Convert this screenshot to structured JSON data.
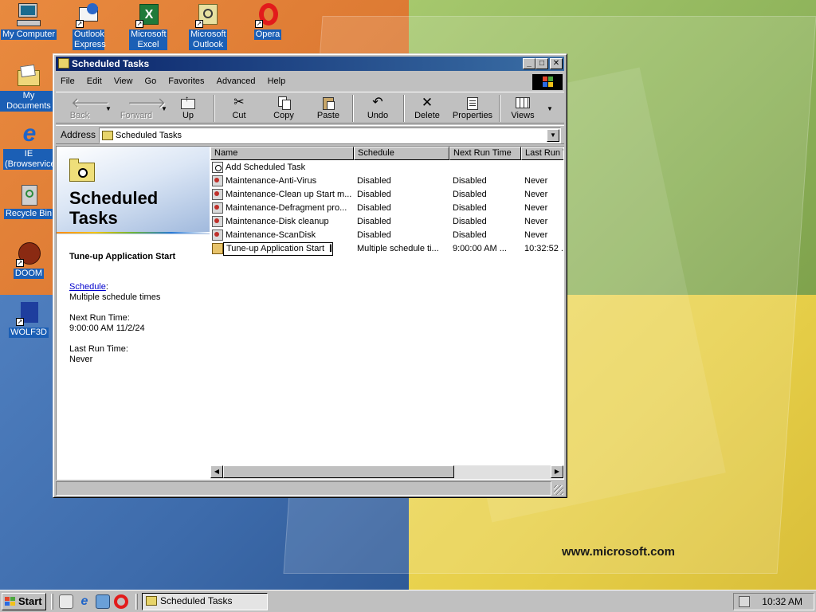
{
  "desktop": {
    "watermark": "www.microsoft.com",
    "icons": [
      {
        "label": "My Computer",
        "icon": "my-computer-icon"
      },
      {
        "label": "Outlook Express",
        "icon": "outlook-express-icon"
      },
      {
        "label": "Microsoft Excel",
        "icon": "excel-icon"
      },
      {
        "label": "Microsoft Outlook",
        "icon": "outlook-icon"
      },
      {
        "label": "Opera",
        "icon": "opera-icon"
      },
      {
        "label": "My Documents",
        "icon": "my-documents-icon"
      },
      {
        "label": "IE (Browservice)",
        "icon": "internet-explorer-icon"
      },
      {
        "label": "Recycle Bin",
        "icon": "recycle-bin-icon"
      },
      {
        "label": "DOOM",
        "icon": "doom-icon"
      },
      {
        "label": "WOLF3D",
        "icon": "wolf3d-icon"
      }
    ]
  },
  "window": {
    "title": "Scheduled Tasks",
    "menu": [
      {
        "label": "File",
        "key": "F"
      },
      {
        "label": "Edit",
        "key": "E"
      },
      {
        "label": "View",
        "key": "V"
      },
      {
        "label": "Go",
        "key": "G"
      },
      {
        "label": "Favorites",
        "key": "a"
      },
      {
        "label": "Advanced",
        "key": "A"
      },
      {
        "label": "Help",
        "key": "H"
      }
    ],
    "toolbar": {
      "back": "Back",
      "forward": "Forward",
      "up": "Up",
      "cut": "Cut",
      "copy": "Copy",
      "paste": "Paste",
      "undo": "Undo",
      "delete": "Delete",
      "properties": "Properties",
      "views": "Views"
    },
    "address": {
      "label": "Address",
      "value": "Scheduled Tasks"
    },
    "left_pane": {
      "title": "Scheduled Tasks",
      "selected_name": "Tune-up Application Start",
      "schedule_label": "Schedule",
      "schedule_value": "Multiple schedule times",
      "next_run_label": "Next Run Time:",
      "next_run_value": "9:00:00 AM 11/2/24",
      "last_run_label": "Last Run Time:",
      "last_run_value": "Never"
    },
    "columns": [
      "Name",
      "Schedule",
      "Next Run Time",
      "Last Run T"
    ],
    "rows": [
      {
        "name": "Add Scheduled Task",
        "schedule": "",
        "next": "",
        "last": "",
        "icon": "add-task-icon"
      },
      {
        "name": "Maintenance-Anti-Virus",
        "schedule": "Disabled",
        "next": "Disabled",
        "last": "Never",
        "icon": "task-icon"
      },
      {
        "name": "Maintenance-Clean up Start m...",
        "schedule": "Disabled",
        "next": "Disabled",
        "last": "Never",
        "icon": "task-icon"
      },
      {
        "name": "Maintenance-Defragment pro...",
        "schedule": "Disabled",
        "next": "Disabled",
        "last": "Never",
        "icon": "task-icon"
      },
      {
        "name": "Maintenance-Disk cleanup",
        "schedule": "Disabled",
        "next": "Disabled",
        "last": "Never",
        "icon": "task-icon"
      },
      {
        "name": "Maintenance-ScanDisk",
        "schedule": "Disabled",
        "next": "Disabled",
        "last": "Never",
        "icon": "task-icon"
      },
      {
        "name": "Tune-up Application Start",
        "schedule": "Multiple schedule ti...",
        "next": "9:00:00 AM ...",
        "last": "10:32:52 .",
        "icon": "tune-up-icon",
        "renaming": true
      }
    ]
  },
  "taskbar": {
    "start_label": "Start",
    "task_button": "Scheduled Tasks",
    "clock": "10:32 AM"
  }
}
